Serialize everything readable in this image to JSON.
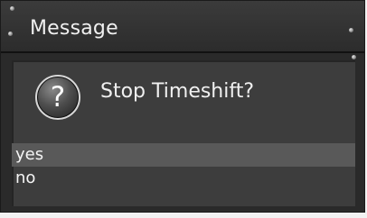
{
  "dialog": {
    "title": "Message",
    "question_icon": "question-icon",
    "question_glyph": "?",
    "message": "Stop Timeshift?",
    "options": [
      {
        "label": "yes",
        "selected": true
      },
      {
        "label": "no",
        "selected": false
      }
    ]
  },
  "colors": {
    "background": "#2a2a2a",
    "content": "#3d3d3d",
    "selection": "#595959",
    "text": "#f0f0f0"
  }
}
